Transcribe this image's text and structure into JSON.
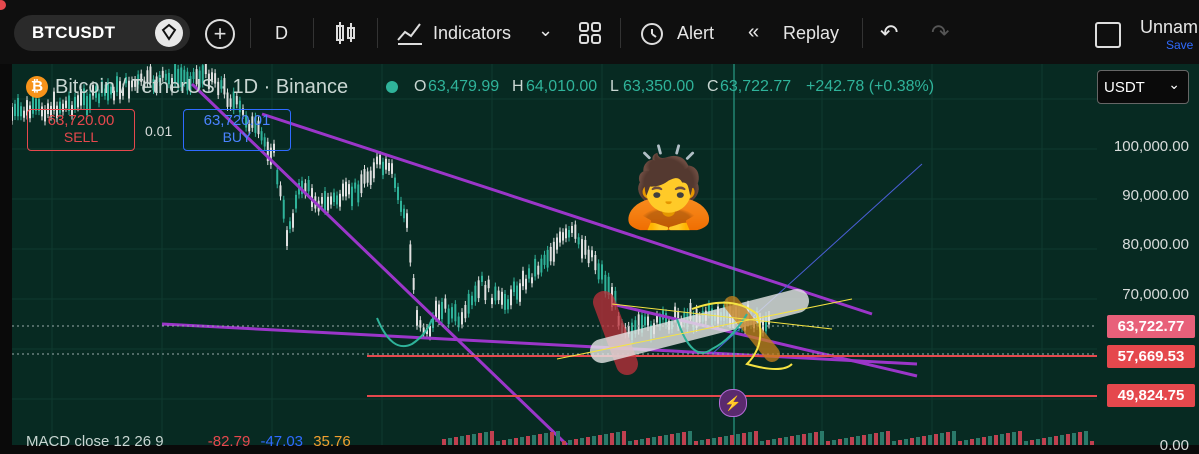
{
  "toolbar": {
    "symbol": "BTCUSDT",
    "interval": "D",
    "indicators_label": "Indicators",
    "alert_label": "Alert",
    "replay_label": "Replay",
    "layout_name": "Unnam",
    "save_label": "Save"
  },
  "legend": {
    "title": "Bitcoin / TetherUS · 1D · Binance",
    "open_key": "O",
    "open_value": "63,479.99",
    "high_key": "H",
    "high_value": "64,010.00",
    "low_key": "L",
    "low_value": "63,350.00",
    "close_key": "C",
    "close_value": "63,722.77",
    "change": "+242.78 (+0.38%)"
  },
  "trade": {
    "sell_price": "63,720.00",
    "sell_label": "SELL",
    "spread": "0.01",
    "buy_price": "63,720.01",
    "buy_label": "BUY"
  },
  "price_axis": {
    "currency": "USDT",
    "ticks": [
      "100,000.00",
      "90,000.00",
      "80,000.00",
      "70,000.00",
      "0.00"
    ],
    "last_price_tag": "63,722.77",
    "line_tag_1": "57,669.53",
    "line_tag_2": "49,824.75"
  },
  "macd": {
    "label": "MACD close 12 26 9",
    "v1": "-82.79",
    "v2": "-47.03",
    "v3": "35.76"
  },
  "colors": {
    "bg": "#072a22",
    "up": "#2fb39a",
    "down": "#e0e0e0",
    "sell": "#e5484d",
    "buy": "#2f6bff",
    "trend": "#9b36c9",
    "hline": "#e5484d"
  },
  "emoji": "🙇"
}
